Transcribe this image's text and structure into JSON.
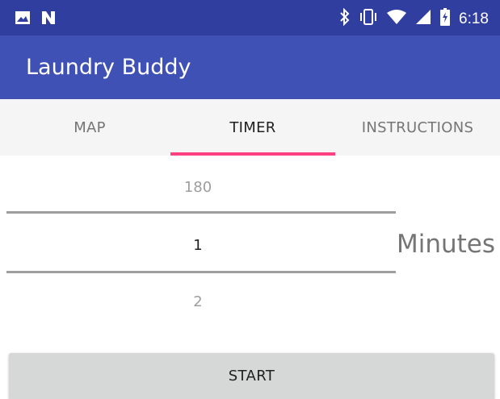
{
  "status_bar": {
    "time": "6:18",
    "icons": [
      "image-icon",
      "n-logo-icon",
      "bluetooth-icon",
      "vibrate-icon",
      "wifi-icon",
      "signal-icon",
      "battery-charging-icon"
    ]
  },
  "app_bar": {
    "title": "Laundry Buddy",
    "background_color": "#3f51b5",
    "status_color": "#303f9f"
  },
  "tabs": [
    {
      "label": "MAP",
      "active": false
    },
    {
      "label": "TIMER",
      "active": true
    },
    {
      "label": "INSTRUCTIONS",
      "active": false
    }
  ],
  "accent_color": "#ff4081",
  "picker": {
    "previous": "180",
    "selected": "1",
    "next": "2",
    "unit_label": "Minutes"
  },
  "start_button": {
    "label": "START"
  }
}
